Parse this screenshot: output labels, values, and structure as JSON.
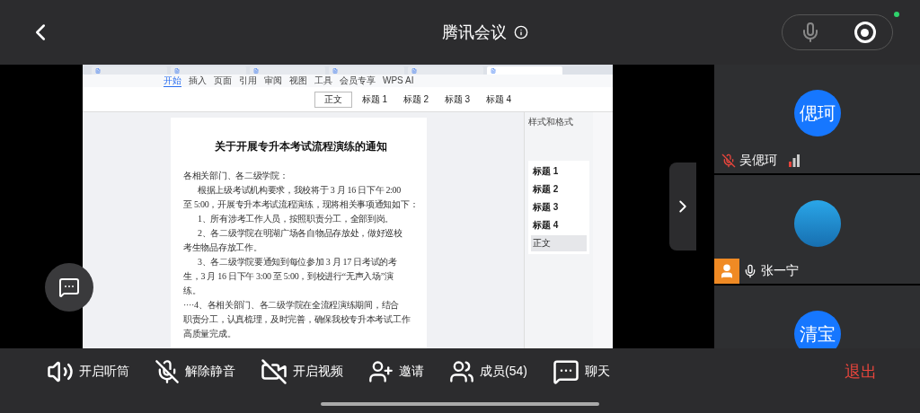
{
  "header": {
    "title": "腾讯会议"
  },
  "shared_screen": {
    "browser_tabs": [
      {
        "selected": false
      },
      {
        "selected": false
      },
      {
        "selected": false
      },
      {
        "selected": false
      },
      {
        "selected": false
      },
      {
        "selected": true
      }
    ],
    "ribbon_tabs": [
      {
        "label": "开始",
        "selected": true
      },
      {
        "label": "插入",
        "selected": false
      },
      {
        "label": "页面",
        "selected": false
      },
      {
        "label": "引用",
        "selected": false
      },
      {
        "label": "审阅",
        "selected": false
      },
      {
        "label": "视图",
        "selected": false
      },
      {
        "label": "工具",
        "selected": false
      },
      {
        "label": "会员专享",
        "selected": false
      },
      {
        "label": "WPS AI",
        "selected": false
      }
    ],
    "style_gallery": [
      {
        "label": "正文",
        "selected": true
      },
      {
        "label": "标题 1",
        "selected": false
      },
      {
        "label": "标题 2",
        "selected": false
      },
      {
        "label": "标题 3",
        "selected": false
      },
      {
        "label": "标题 4",
        "selected": false
      }
    ],
    "document": {
      "title": "关于开展专升本考试流程演练的通知",
      "lines": [
        {
          "text": "各相关部门、各二级学院：",
          "indent": false
        },
        {
          "text": "根据上级考试机构要求，我校将于 3 月 16 日下午 2:00",
          "indent": true
        },
        {
          "text": "至 5:00，开展专升本考试流程演练，现将相关事项通知如下：",
          "indent": false
        },
        {
          "text": "1、所有涉考工作人员，按照职责分工，全部到岗。",
          "indent": true
        },
        {
          "text": "2、各二级学院在明湖广场各自物品存放处，做好巡校",
          "indent": true
        },
        {
          "text": "考生物品存放工作。",
          "indent": false
        },
        {
          "text": "3、各二级学院要通知到每位参加 3 月 17 日考试的考",
          "indent": true
        },
        {
          "text": "生，3 月 16 日下午 3:00 至 5:00，到校进行“无声入场”演",
          "indent": false
        },
        {
          "text": "练。",
          "indent": false
        },
        {
          "text": "····4、各相关部门、各二级学院在全流程演练期间，结合",
          "indent": false
        },
        {
          "text": "职责分工，认真梳理，及时完善，确保我校专升本考试工作",
          "indent": false
        },
        {
          "text": "高质量完成。",
          "indent": false
        }
      ]
    },
    "styles_panel": {
      "title": "样式和格式",
      "items": [
        {
          "label": "标题 1",
          "selected": false
        },
        {
          "label": "标题 2",
          "selected": false
        },
        {
          "label": "标题 3",
          "selected": false
        },
        {
          "label": "标题 4",
          "selected": false
        },
        {
          "label": "正文",
          "selected": true
        }
      ]
    }
  },
  "participants": [
    {
      "kind": "text",
      "avatar_text": "偲珂",
      "name": "吴偲珂",
      "muted": true,
      "badge": false
    },
    {
      "kind": "photo",
      "name": "张一宁",
      "muted": false,
      "badge": true
    },
    {
      "kind": "text",
      "avatar_text": "清宝",
      "badge": false
    }
  ],
  "toolbar": [
    {
      "kind": "speaker",
      "label": "开启听筒"
    },
    {
      "kind": "mic_off",
      "label": "解除静音"
    },
    {
      "kind": "video_off",
      "label": "开启视频"
    },
    {
      "kind": "invite",
      "label": "邀请"
    },
    {
      "kind": "members",
      "label": "成员(54)"
    },
    {
      "kind": "chat",
      "label": "聊天"
    }
  ],
  "leave_button": {
    "label": "退出"
  }
}
